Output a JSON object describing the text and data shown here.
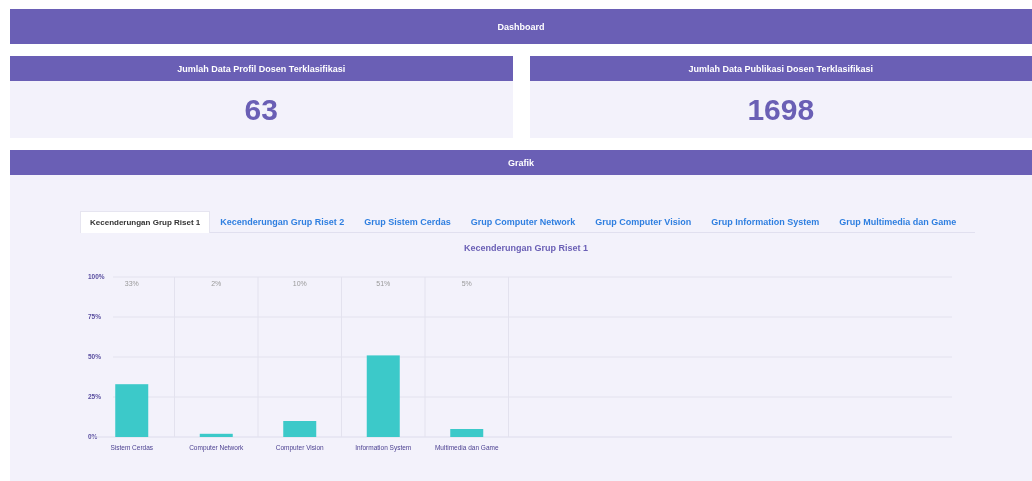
{
  "header": {
    "title": "Dashboard"
  },
  "stats": [
    {
      "title": "Jumlah Data Profil Dosen Terklasifikasi",
      "value": "63"
    },
    {
      "title": "Jumlah Data Publikasi Dosen Terklasifikasi",
      "value": "1698"
    }
  ],
  "chart_panel": {
    "title": "Grafik",
    "tabs": [
      {
        "label": "Kecenderungan Grup Riset 1",
        "selected": true
      },
      {
        "label": "Kecenderungan Grup Riset 2",
        "selected": false
      },
      {
        "label": "Grup Sistem Cerdas",
        "selected": false
      },
      {
        "label": "Grup Computer Network",
        "selected": false
      },
      {
        "label": "Grup Computer Vision",
        "selected": false
      },
      {
        "label": "Grup Information System",
        "selected": false
      },
      {
        "label": "Grup Multimedia dan Game",
        "selected": false
      }
    ],
    "chart_data": {
      "type": "bar",
      "title": "Kecenderungan Grup Riset 1",
      "categories": [
        "Sistem Cerdas",
        "Computer Network",
        "Computer Vision",
        "Information System",
        "Multimedia dan Game"
      ],
      "series": [
        {
          "color": "#3cc9c9",
          "values": [
            33,
            2,
            10,
            51,
            5
          ]
        }
      ],
      "grid": true,
      "ylim": [
        0,
        100
      ],
      "yticks": [
        {
          "value": 0,
          "label": "0%"
        },
        {
          "value": 25,
          "label": "25%"
        },
        {
          "value": 50,
          "label": "50%"
        },
        {
          "value": 75,
          "label": "75%"
        },
        {
          "value": 100,
          "label": "100%"
        }
      ],
      "value_labels": [
        "33%",
        "2%",
        "10%",
        "51%",
        "5%"
      ]
    }
  }
}
